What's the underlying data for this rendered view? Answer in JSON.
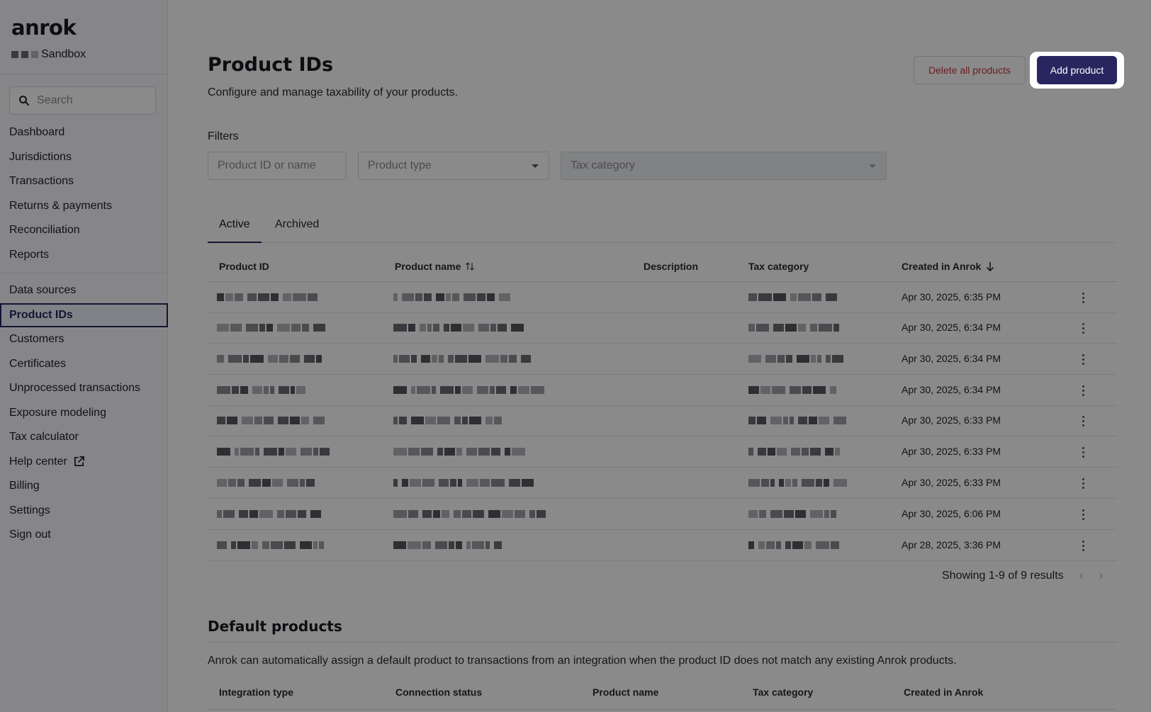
{
  "sidebar": {
    "logo": "anrok",
    "org_suffix": "Sandbox",
    "search_placeholder": "Search",
    "nav_top": [
      {
        "label": "Dashboard"
      },
      {
        "label": "Jurisdictions"
      },
      {
        "label": "Transactions"
      },
      {
        "label": "Returns & payments"
      },
      {
        "label": "Reconciliation"
      },
      {
        "label": "Reports"
      }
    ],
    "nav_bottom": [
      {
        "label": "Data sources"
      },
      {
        "label": "Product IDs",
        "active": true
      },
      {
        "label": "Customers"
      },
      {
        "label": "Certificates"
      },
      {
        "label": "Unprocessed transactions"
      },
      {
        "label": "Exposure modeling"
      },
      {
        "label": "Tax calculator"
      },
      {
        "label": "Help center",
        "external_icon": "external-link-icon"
      },
      {
        "label": "Billing"
      },
      {
        "label": "Settings"
      },
      {
        "label": "Sign out"
      }
    ]
  },
  "header": {
    "title": "Product IDs",
    "subtitle": "Configure and manage taxability of your products.",
    "delete_label": "Delete all products",
    "add_label": "Add product"
  },
  "filters": {
    "label": "Filters",
    "product_id_placeholder": "Product ID or name",
    "product_type_placeholder": "Product type",
    "tax_category_placeholder": "Tax category"
  },
  "tabs": [
    {
      "label": "Active",
      "active": true
    },
    {
      "label": "Archived"
    }
  ],
  "table": {
    "columns": [
      "Product ID",
      "Product name",
      "Description",
      "Tax category",
      "Created in Anrok"
    ],
    "rows": [
      {
        "created": "Apr 30, 2025, 6:35 PM"
      },
      {
        "created": "Apr 30, 2025, 6:34 PM"
      },
      {
        "created": "Apr 30, 2025, 6:34 PM"
      },
      {
        "created": "Apr 30, 2025, 6:34 PM"
      },
      {
        "created": "Apr 30, 2025, 6:33 PM"
      },
      {
        "created": "Apr 30, 2025, 6:33 PM"
      },
      {
        "created": "Apr 30, 2025, 6:33 PM"
      },
      {
        "created": "Apr 30, 2025, 6:06 PM"
      },
      {
        "created": "Apr 28, 2025, 3:36 PM"
      }
    ],
    "pager_text": "Showing 1-9 of 9 results"
  },
  "default_products": {
    "title": "Default products",
    "description": "Anrok can automatically assign a default product to transactions from an integration when the product ID does not match any existing Anrok products.",
    "columns": [
      "Integration type",
      "Connection status",
      "Product name",
      "Tax category",
      "Created in Anrok"
    ]
  },
  "colors": {
    "brand": "#27265f",
    "danger": "#c8373c"
  }
}
